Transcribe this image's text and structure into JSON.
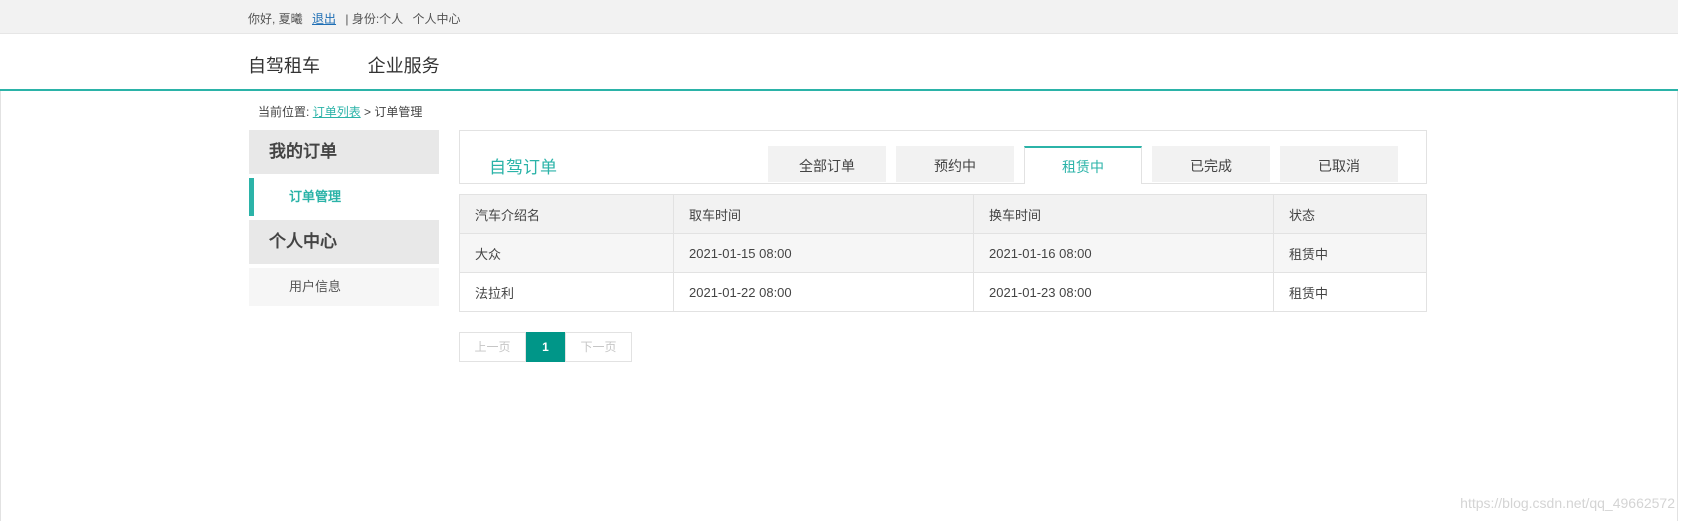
{
  "topbar": {
    "greeting": "你好, 夏曦",
    "logout": "退出",
    "identity": "| 身份:个人",
    "personal_center": "个人中心"
  },
  "nav": [
    "自驾租车",
    "企业服务"
  ],
  "breadcrumb": {
    "prefix": "当前位置:",
    "link": "订单列表",
    "sep": ">",
    "current": "订单管理"
  },
  "sidebar": {
    "group1": "我的订单",
    "item1": "订单管理",
    "group2": "个人中心",
    "item2": "用户信息"
  },
  "panel": {
    "title": "自驾订单",
    "tabs": [
      "全部订单",
      "预约中",
      "租赁中",
      "已完成",
      "已取消"
    ],
    "active_tab": "租赁中"
  },
  "table": {
    "headers": [
      "汽车介绍名",
      "取车时间",
      "换车时间",
      "状态"
    ],
    "rows": [
      [
        "大众",
        "2021-01-15 08:00",
        "2021-01-16 08:00",
        "租赁中"
      ],
      [
        "法拉利",
        "2021-01-22 08:00",
        "2021-01-23 08:00",
        "租赁中"
      ]
    ]
  },
  "pager": {
    "prev": "上一页",
    "current": "1",
    "next": "下一页"
  },
  "watermark": "https://blog.csdn.net/qq_49662572",
  "colors": {
    "accent": "#2bb3a8",
    "page_active": "#009688"
  }
}
